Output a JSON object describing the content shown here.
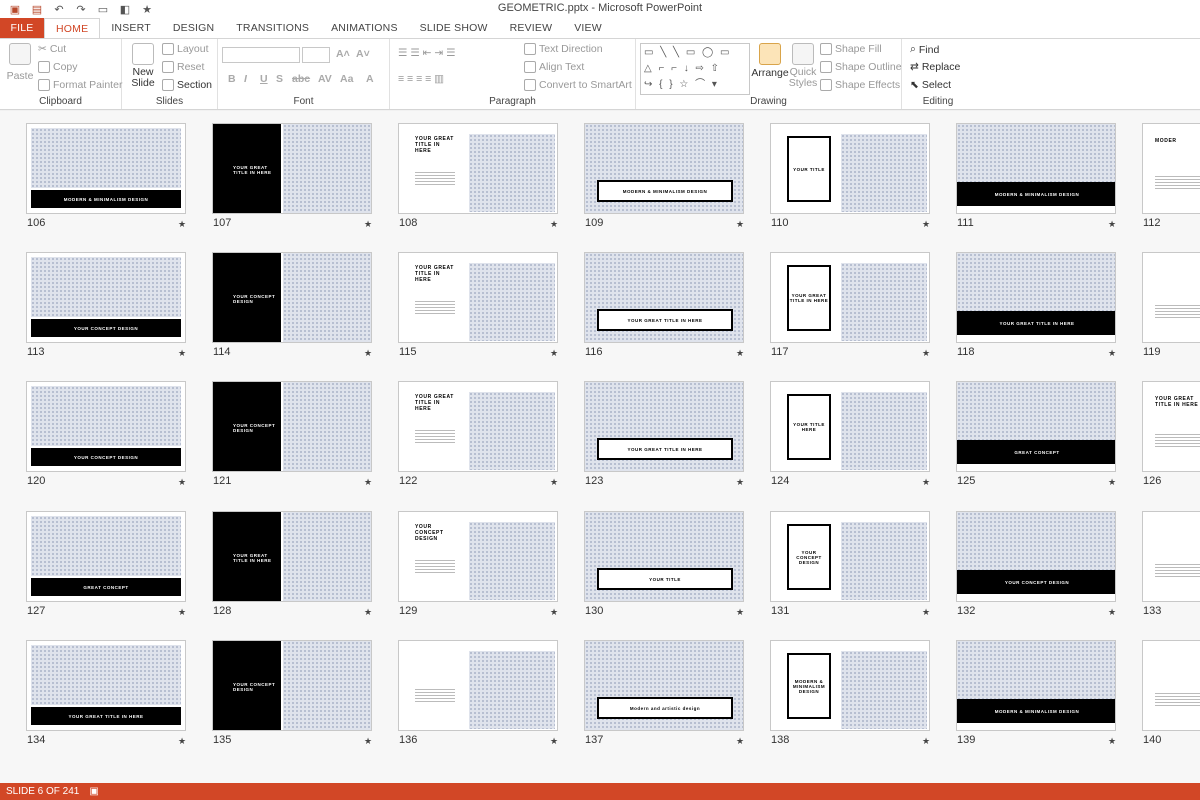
{
  "window": {
    "title": "GEOMETRIC.pptx - Microsoft PowerPoint"
  },
  "qat": [
    "save-icon",
    "undo-icon",
    "redo-icon",
    "present-icon",
    "layout-icon",
    "star-icon"
  ],
  "tabs": [
    {
      "label": "FILE"
    },
    {
      "label": "HOME"
    },
    {
      "label": "INSERT"
    },
    {
      "label": "DESIGN"
    },
    {
      "label": "TRANSITIONS"
    },
    {
      "label": "ANIMATIONS"
    },
    {
      "label": "SLIDE SHOW"
    },
    {
      "label": "REVIEW"
    },
    {
      "label": "VIEW"
    }
  ],
  "ribbon": {
    "clipboard": {
      "label": "Clipboard",
      "paste": "Paste",
      "cut": "Cut",
      "copy": "Copy",
      "format_painter": "Format Painter"
    },
    "slides": {
      "label": "Slides",
      "new_slide": "New",
      "new_slide2": "Slide",
      "layout": "Layout",
      "reset": "Reset",
      "section": "Section"
    },
    "font": {
      "label": "Font"
    },
    "paragraph": {
      "label": "Paragraph",
      "text_direction": "Text Direction",
      "align_text": "Align Text",
      "smartart": "Convert to SmartArt"
    },
    "drawing": {
      "label": "Drawing",
      "arrange": "Arrange",
      "quick_styles": "Quick",
      "quick_styles2": "Styles",
      "shape_fill": "Shape Fill",
      "shape_outline": "Shape Outline",
      "shape_effects": "Shape Effects"
    },
    "editing": {
      "label": "Editing",
      "find": "Find",
      "replace": "Replace",
      "select": "Select"
    }
  },
  "slides": [
    {
      "num": "106",
      "text": "MODERN & MINIMALISM DESIGN"
    },
    {
      "num": "107",
      "text": "YOUR GREAT TITLE IN HERE"
    },
    {
      "num": "108",
      "text": "YOUR GREAT TITLE IN HERE"
    },
    {
      "num": "109",
      "text": "MODERN & MINIMALISM DESIGN"
    },
    {
      "num": "110",
      "text": "YOUR TITLE"
    },
    {
      "num": "111",
      "text": "MODERN & MINIMALISM DESIGN"
    },
    {
      "num": "112",
      "text": "MODER"
    },
    {
      "num": "113",
      "text": "YOUR CONCEPT DESIGN"
    },
    {
      "num": "114",
      "text": "YOUR CONCEPT DESIGN"
    },
    {
      "num": "115",
      "text": "YOUR GREAT TITLE IN HERE"
    },
    {
      "num": "116",
      "text": "YOUR GREAT TITLE IN HERE"
    },
    {
      "num": "117",
      "text": "YOUR GREAT TITLE IN HERE"
    },
    {
      "num": "118",
      "text": "YOUR GREAT TITLE IN HERE"
    },
    {
      "num": "119",
      "text": ""
    },
    {
      "num": "120",
      "text": "YOUR CONCEPT DESIGN"
    },
    {
      "num": "121",
      "text": "YOUR CONCEPT DESIGN"
    },
    {
      "num": "122",
      "text": "YOUR GREAT TITLE IN HERE"
    },
    {
      "num": "123",
      "text": "YOUR GREAT TITLE IN HERE"
    },
    {
      "num": "124",
      "text": "YOUR TITLE HERE"
    },
    {
      "num": "125",
      "text": "GREAT CONCEPT"
    },
    {
      "num": "126",
      "text": "YOUR GREAT TITLE IN HERE"
    },
    {
      "num": "127",
      "text": "GREAT CONCEPT"
    },
    {
      "num": "128",
      "text": "YOUR GREAT TITLE IN HERE"
    },
    {
      "num": "129",
      "text": "YOUR CONCEPT DESIGN"
    },
    {
      "num": "130",
      "text": "YOUR TITLE"
    },
    {
      "num": "131",
      "text": "YOUR CONCEPT DESIGN"
    },
    {
      "num": "132",
      "text": "YOUR CONCEPT DESIGN"
    },
    {
      "num": "133",
      "text": ""
    },
    {
      "num": "134",
      "text": "YOUR GREAT TITLE IN HERE"
    },
    {
      "num": "135",
      "text": "YOUR CONCEPT DESIGN"
    },
    {
      "num": "136",
      "text": ""
    },
    {
      "num": "137",
      "text": "Modern and artistic design"
    },
    {
      "num": "138",
      "text": "MODERN & MINIMALISM DESIGN"
    },
    {
      "num": "139",
      "text": "MODERN & MINIMALISM DESIGN"
    },
    {
      "num": "140",
      "text": ""
    }
  ],
  "status": {
    "slide_info": "SLIDE 6 OF 241"
  }
}
